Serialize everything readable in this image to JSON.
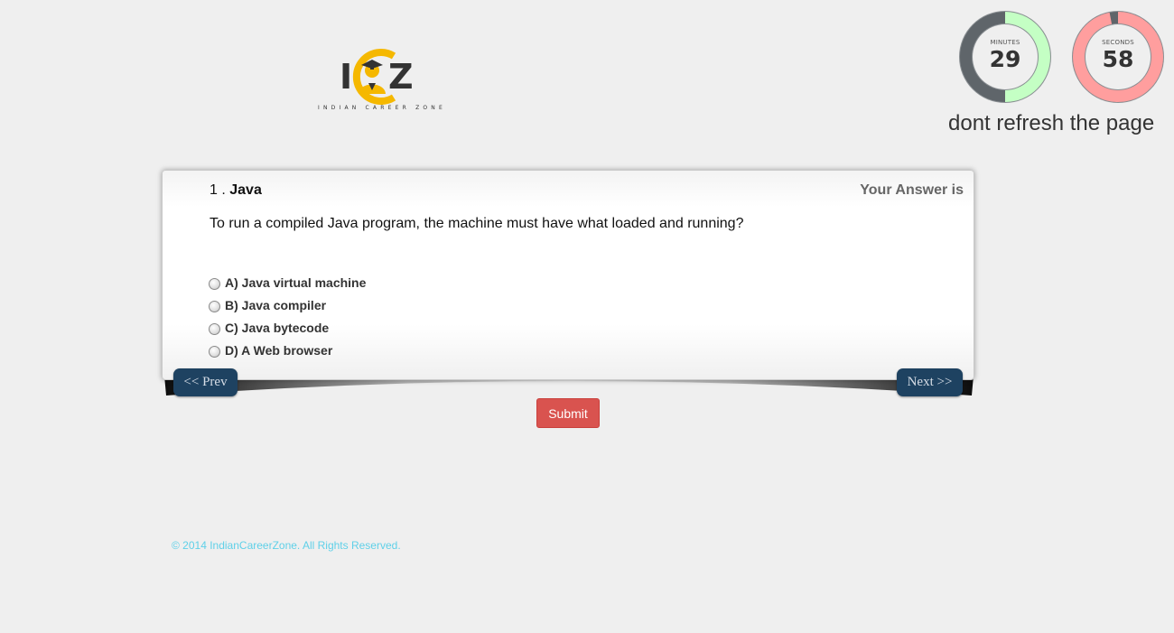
{
  "brand": {
    "logo_letters_left": "I",
    "logo_letters_right": "Z",
    "tagline": "INDIAN CAREER ZONE",
    "accent_color": "#f5b800"
  },
  "timer": {
    "minutes_label": "MINUTES",
    "minutes_value": "29",
    "minutes_fraction_remaining": 0.5,
    "minutes_color": "#c4ffc4",
    "seconds_label": "SECONDS",
    "seconds_value": "58",
    "seconds_fraction_remaining": 0.97,
    "seconds_color": "#ff9e9e",
    "elapsed_color": "#5f656a"
  },
  "warning": "dont refresh the page",
  "question": {
    "number": "1 .",
    "subject": "Java",
    "answer_status": "Your Answer is",
    "text": "To run a compiled Java program, the machine must have what loaded and running?",
    "options": [
      {
        "label": "A) Java virtual machine"
      },
      {
        "label": "B) Java compiler"
      },
      {
        "label": "C) Java bytecode"
      },
      {
        "label": "D) A Web browser"
      }
    ]
  },
  "nav": {
    "prev_label": "<< Prev",
    "next_label": "Next >>",
    "submit_label": "Submit"
  },
  "footer": {
    "copyright": "© 2014 IndianCareerZone. All Rights Reserved."
  }
}
